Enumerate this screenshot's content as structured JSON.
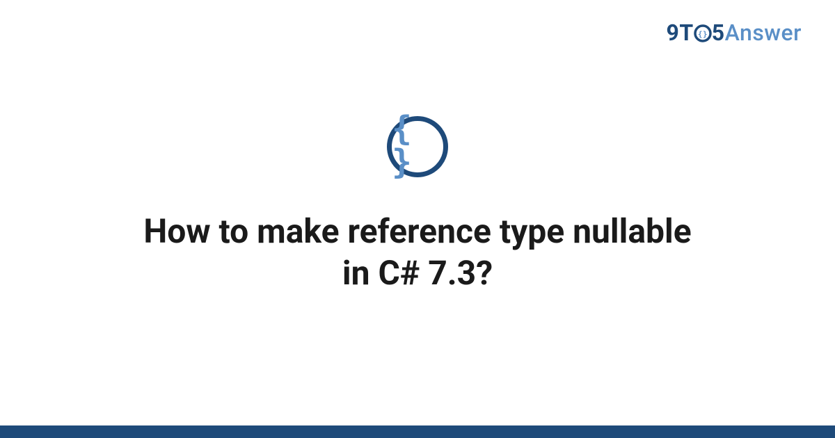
{
  "brand": {
    "part1": "9",
    "part2": "T",
    "part3": "5",
    "part4": "Answer"
  },
  "icon": {
    "name": "code-braces-icon",
    "glyph": "{ }"
  },
  "title": "How to make reference type nullable in C# 7.3?",
  "colors": {
    "primary": "#1e4a7a",
    "accent": "#5a8fc7",
    "text": "#1a1a1a"
  }
}
